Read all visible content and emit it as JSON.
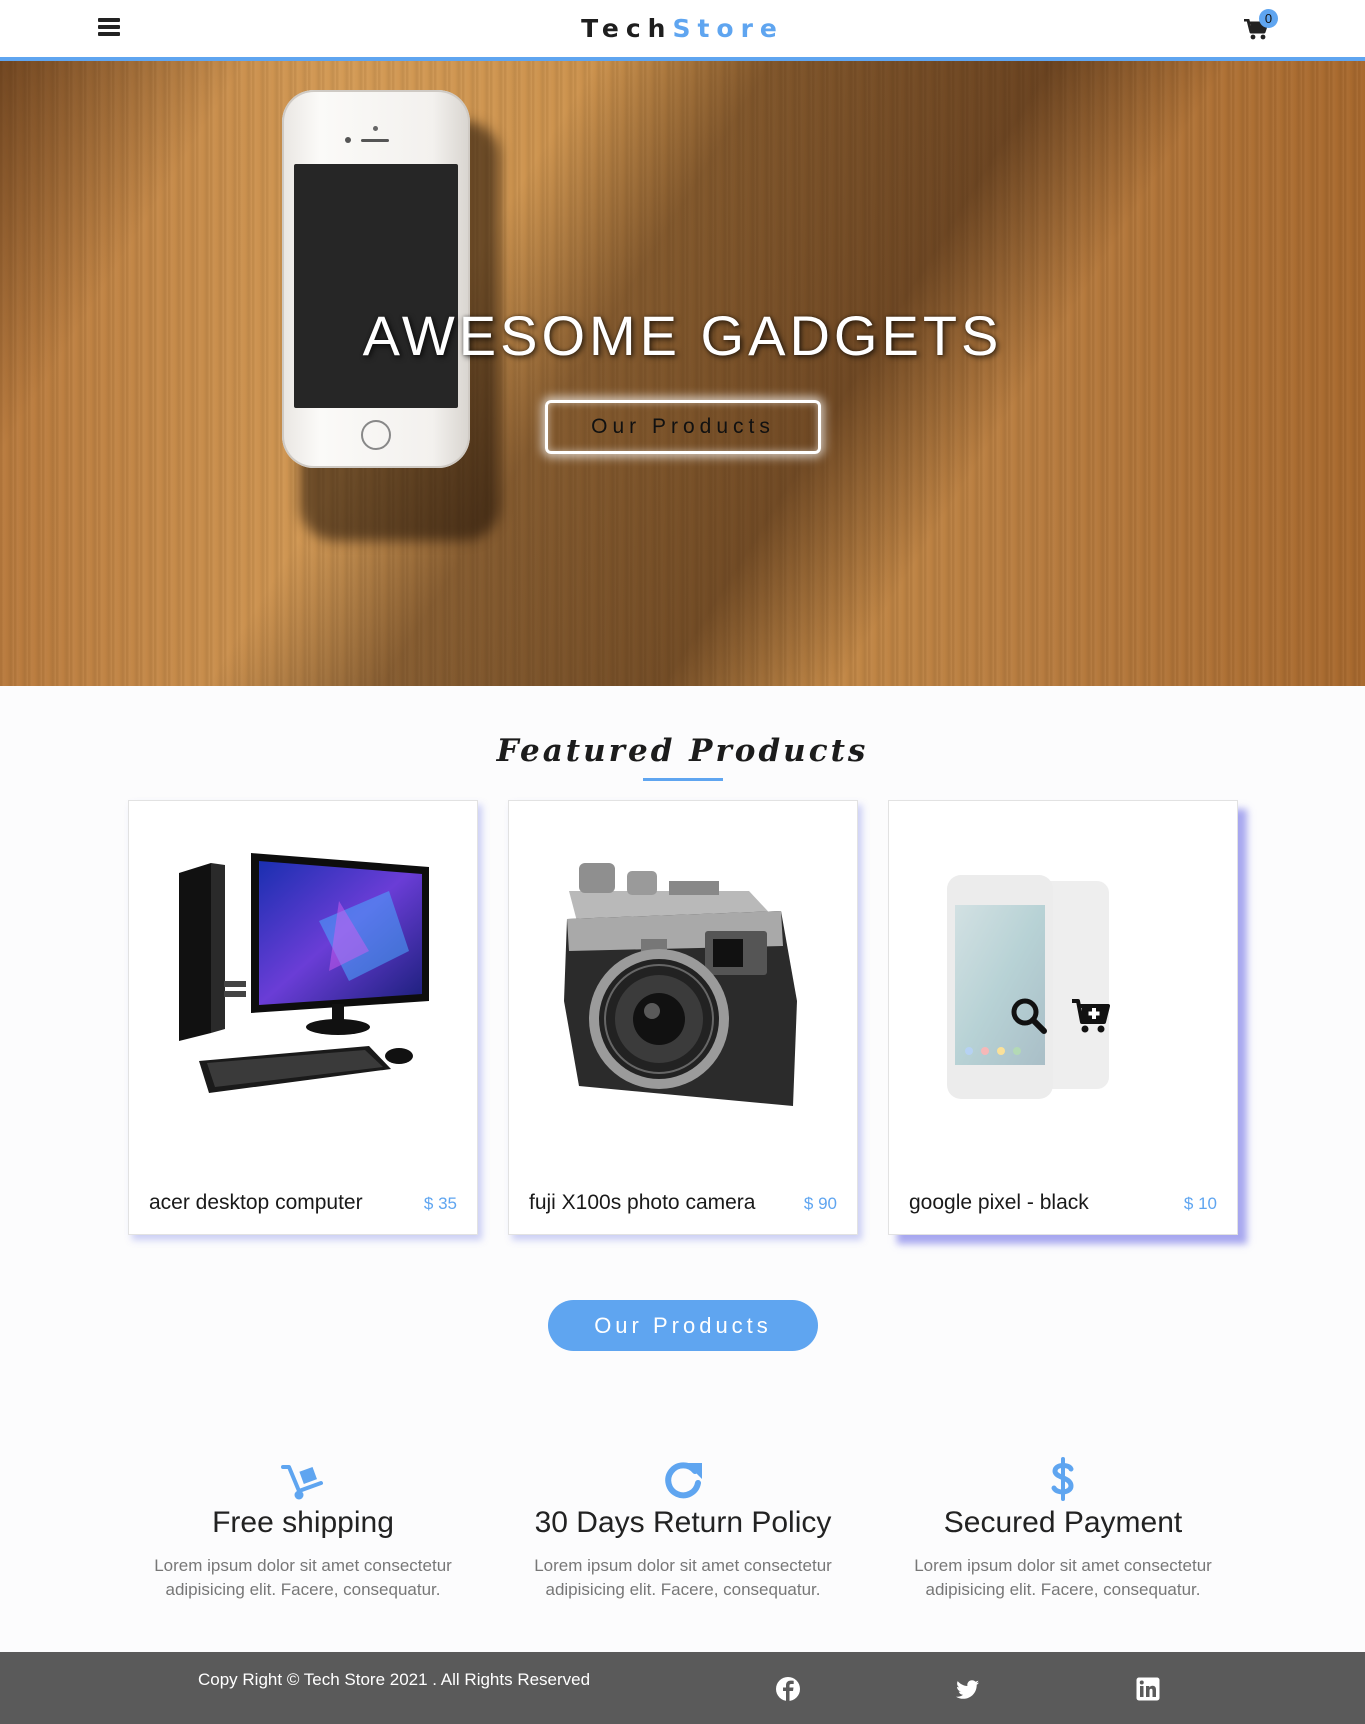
{
  "navbar": {
    "brand_part1": "Tech",
    "brand_part2": "Store",
    "cart_count": "0"
  },
  "hero": {
    "title": "AWESOME GADGETS",
    "button_label": "Our Products"
  },
  "featured": {
    "title": "Featured Products",
    "products": [
      {
        "name": "acer desktop computer",
        "price": "$ 35"
      },
      {
        "name": "fuji X100s photo camera",
        "price": "$ 90"
      },
      {
        "name": "google pixel - black",
        "price": "$ 10"
      }
    ],
    "button_label": "Our Products"
  },
  "services": [
    {
      "icon": "dolly-icon",
      "title": "Free shipping",
      "text": "Lorem ipsum dolor sit amet consectetur adipisicing elit. Facere, consequatur."
    },
    {
      "icon": "redo-icon",
      "title": "30 Days Return Policy",
      "text": "Lorem ipsum dolor sit amet consectetur adipisicing elit. Facere, consequatur."
    },
    {
      "icon": "dollar-icon",
      "title": "Secured Payment",
      "text": "Lorem ipsum dolor sit amet consectetur adipisicing elit. Facere, consequatur."
    }
  ],
  "footer": {
    "copyright": "Copy Right © Tech Store 2021 . All Rights Reserved",
    "social": [
      "facebook-icon",
      "twitter-icon",
      "linkedin-icon"
    ]
  },
  "colors": {
    "accent": "#5fa5f0",
    "footer_bg": "#5a5a5a",
    "card_shadow": "#6e6ee6"
  }
}
